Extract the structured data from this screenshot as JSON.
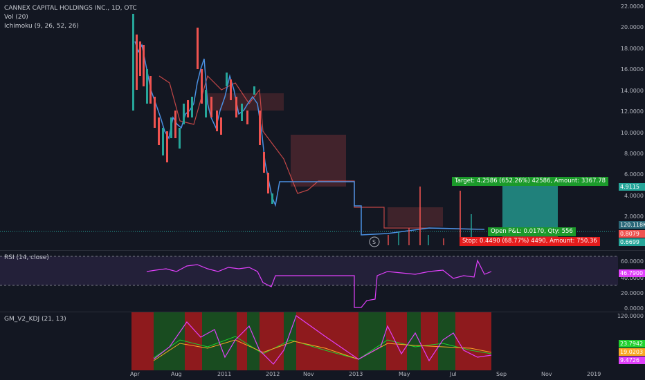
{
  "main": {
    "title": "CANNEX CAPITAL HOLDINGS INC., 1D, OTC",
    "indicators": [
      "Vol (20)",
      "Ichimoku (9, 26, 52, 26)"
    ],
    "price_axis": [
      "22.0000",
      "20.0000",
      "18.0000",
      "16.0000",
      "14.0000",
      "12.0000",
      "10.0000",
      "8.0000",
      "6.0000",
      "4.0000",
      "2.0000"
    ],
    "price_tags": [
      {
        "value": "4.9115",
        "color": "#26a69a"
      },
      {
        "value": "120.118K",
        "color": "#2a6878"
      },
      {
        "value": "0.8079",
        "color": "#ef5350"
      },
      {
        "value": "0.6699",
        "color": "#26a69a"
      }
    ],
    "target_label": "Target: 4.2586 (652.26%) 42586, Amount: 3367.78",
    "open_label": "Open P&L: 0.0170, Qty: 556",
    "stop_label": "Stop: 0.4490 (68.77%) 4490, Amount: 750.36",
    "s_marker": "S"
  },
  "rsi": {
    "title": "RSI (14, close)",
    "axis": [
      "60.0000",
      "40.0000",
      "20.0000",
      "0.0000"
    ],
    "tag": {
      "value": "46.7900",
      "color": "#e040fb"
    }
  },
  "kdj": {
    "title": "GM_V2_KDJ (21, 13)",
    "axis": [
      "120.0000",
      "0.0000"
    ],
    "tags": [
      {
        "value": "23.7942",
        "color": "#1fd12e"
      },
      {
        "value": "19.0203",
        "color": "#f9a825"
      },
      {
        "value": "9.4726",
        "color": "#e040fb"
      }
    ]
  },
  "time_axis": [
    "Apr",
    "Aug",
    "2011",
    "2012",
    "Nov",
    "2013",
    "May",
    "Jul",
    "Sep",
    "Nov",
    "2019"
  ],
  "colors": {
    "bg": "#131722",
    "up": "#26a69a",
    "down": "#ef5350",
    "rsi": "#e040fb"
  }
}
